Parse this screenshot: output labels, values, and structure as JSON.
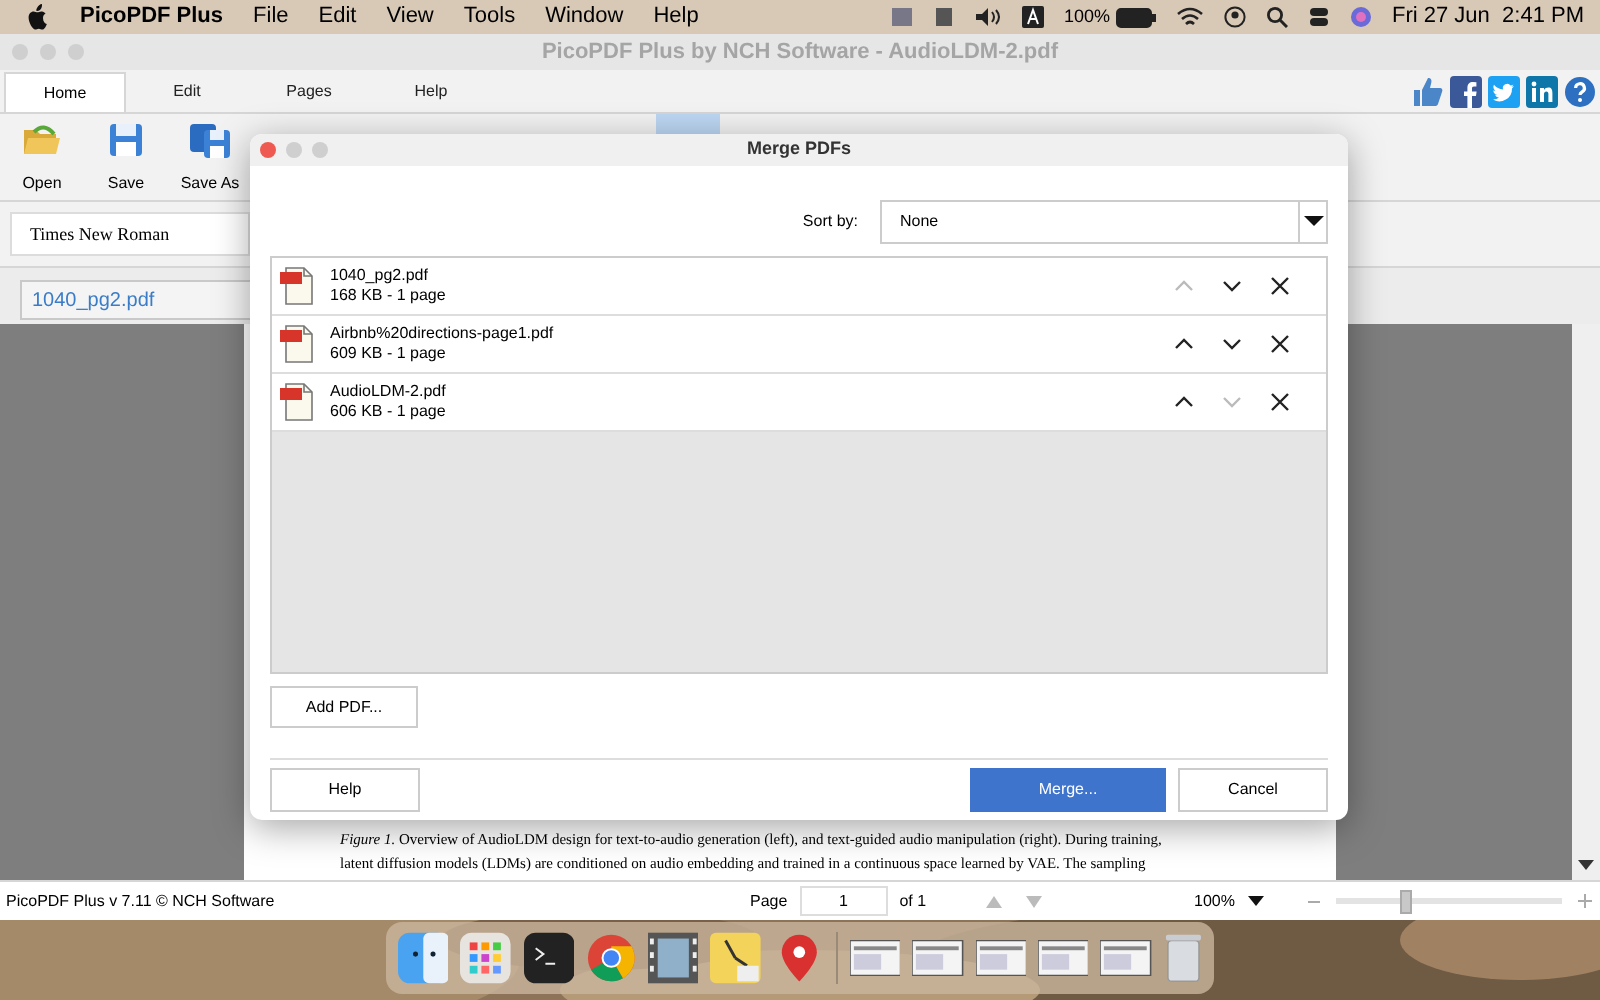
{
  "menubar": {
    "app": "PicoPDF Plus",
    "items": [
      "File",
      "Edit",
      "View",
      "Tools",
      "Window",
      "Help"
    ],
    "battery": "100%",
    "clock": "Fri 27 Jun  2:41 PM"
  },
  "window": {
    "title": "PicoPDF Plus by NCH Software - AudioLDM-2.pdf"
  },
  "tabs": [
    {
      "label": "Home",
      "selected": true
    },
    {
      "label": "Edit",
      "selected": false
    },
    {
      "label": "Pages",
      "selected": false
    },
    {
      "label": "Help",
      "selected": false
    }
  ],
  "toolbar": [
    {
      "label": "Open",
      "kind": "open"
    },
    {
      "label": "Save",
      "kind": "save"
    },
    {
      "label": "Save As",
      "kind": "saveas"
    }
  ],
  "font_field": {
    "value": "Times New Roman"
  },
  "document_tab": "1040_pg2.pdf",
  "document_text": [
    "*Figure 1.* Overview of AudioLDM design for text-to-audio generation (left), and text-guided audio manipulation (right). During training,",
    "latent diffusion models (LDMs) are conditioned on audio embedding and trained in a continuous space learned by VAE. The sampling"
  ],
  "dialog": {
    "title": "Merge PDFs",
    "sort_label": "Sort by:",
    "sort_value": "None",
    "files": [
      {
        "name": "1040_pg2.pdf",
        "info": "168 KB - 1 page",
        "up_disabled": true,
        "down_disabled": false
      },
      {
        "name": "Airbnb%20directions-page1.pdf",
        "info": "609 KB - 1 page",
        "up_disabled": false,
        "down_disabled": false
      },
      {
        "name": "AudioLDM-2.pdf",
        "info": "606 KB - 1 page",
        "up_disabled": false,
        "down_disabled": true
      }
    ],
    "add_button": "Add PDF...",
    "help_button": "Help",
    "merge_button": "Merge...",
    "cancel_button": "Cancel"
  },
  "status_bar": {
    "app_text": "PicoPDF Plus v 7.11 © NCH Software",
    "page_label": "Page",
    "page_value": "1",
    "page_of": "of 1",
    "zoom": "100%",
    "zoom_slider": {
      "level": 0.3
    }
  }
}
